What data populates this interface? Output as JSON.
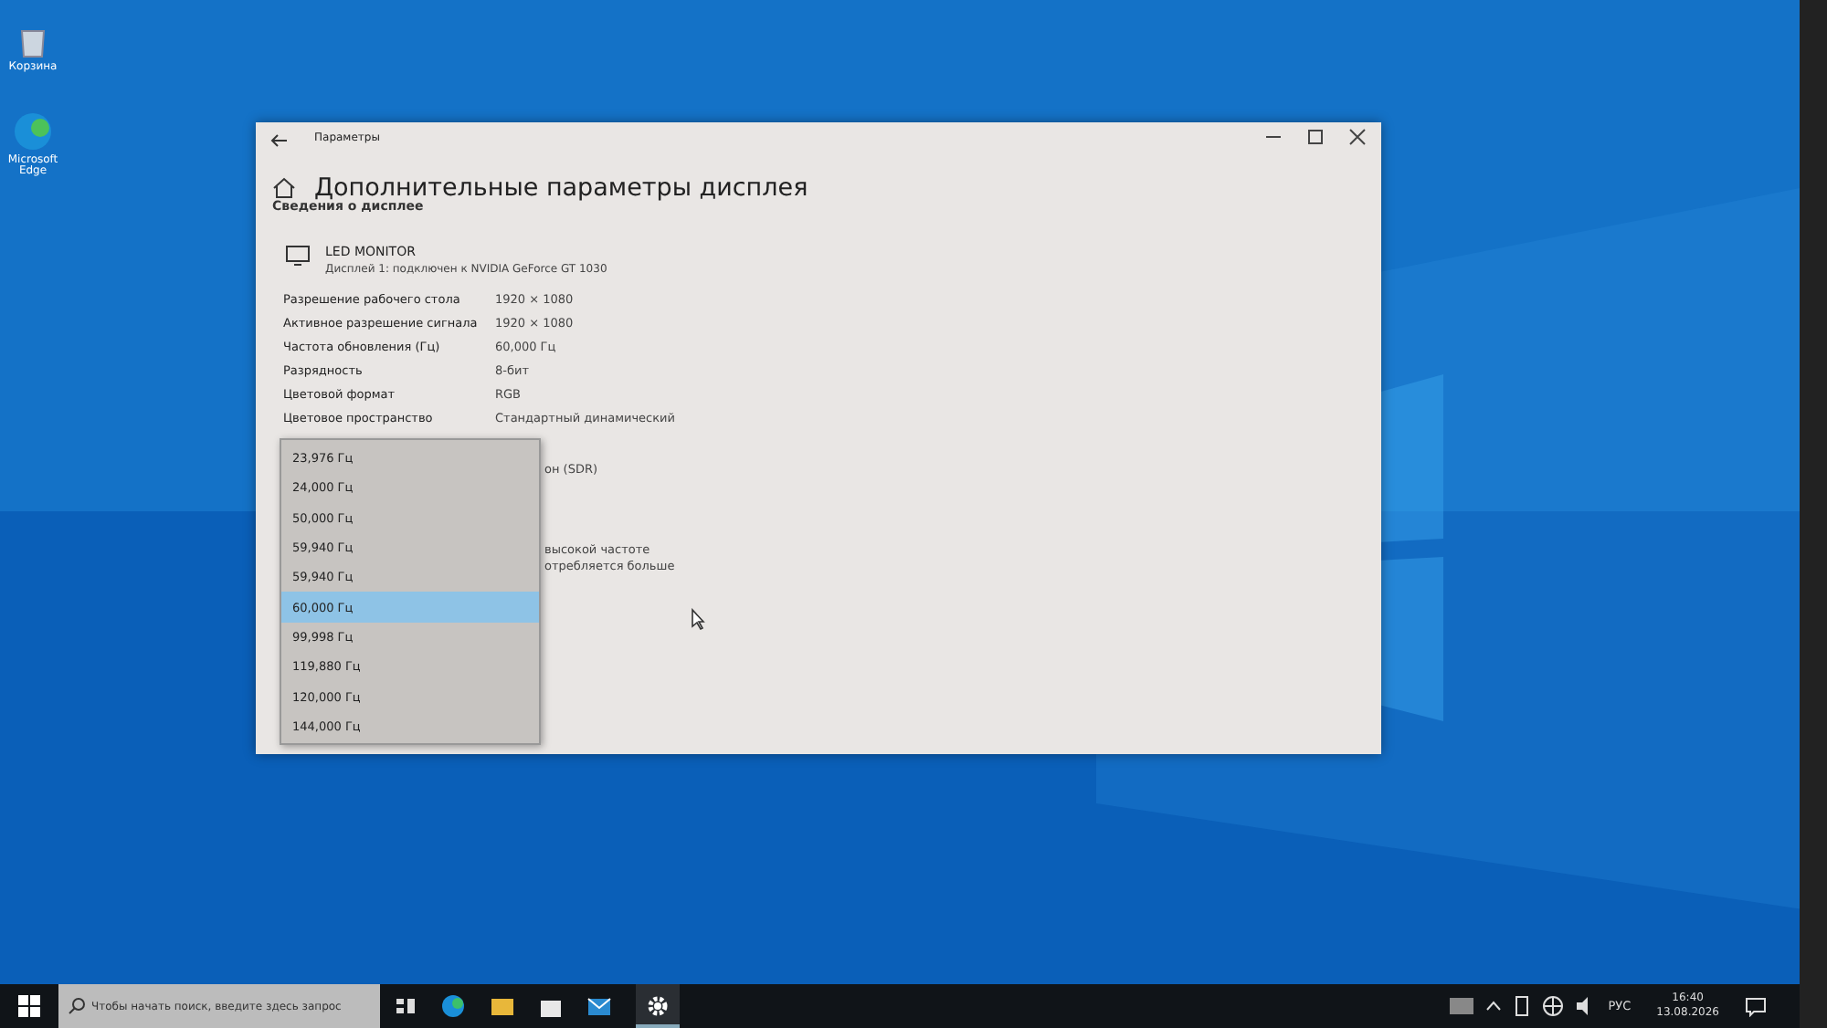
{
  "desktop_icons": [
    {
      "label": "Корзина",
      "kind": "bin"
    },
    {
      "label": "Microsoft Edge",
      "kind": "edge"
    }
  ],
  "window": {
    "title": "Параметры",
    "heading": "Дополнительные параметры дисплея",
    "section_title": "Сведения о дисплее",
    "monitor": {
      "name": "LED MONITOR",
      "description": "Дисплей 1: подключен к NVIDIA GeForce GT 1030"
    },
    "properties": [
      {
        "label": "Разрешение рабочего стола",
        "value": "1920 × 1080"
      },
      {
        "label": "Активное разрешение сигнала",
        "value": "1920 × 1080"
      },
      {
        "label": "Частота обновления (Гц)",
        "value": "60,000 Гц"
      },
      {
        "label": "Разрядность",
        "value": "8-бит"
      },
      {
        "label": "Цветовой формат",
        "value": "RGB"
      },
      {
        "label": "Цветовое пространство",
        "value": "Стандартный динамический"
      }
    ],
    "partial_texts": [
      "он (SDR)",
      "высокой частоте",
      "отребляется больше"
    ]
  },
  "dropdown": [
    {
      "label": "23,976 Гц",
      "selected": false
    },
    {
      "label": "24,000 Гц",
      "selected": false
    },
    {
      "label": "50,000 Гц",
      "selected": false
    },
    {
      "label": "59,940 Гц",
      "selected": false
    },
    {
      "label": "59,940 Гц",
      "selected": false
    },
    {
      "label": "60,000 Гц",
      "selected": true
    },
    {
      "label": "99,998 Гц",
      "selected": false
    },
    {
      "label": "119,880 Гц",
      "selected": false
    },
    {
      "label": "120,000 Гц",
      "selected": false
    },
    {
      "label": "144,000 Гц",
      "selected": false
    }
  ],
  "taskbar": {
    "search_placeholder": "Чтобы начать поиск, введите здесь запрос",
    "language": "РУС",
    "time": "16:40",
    "date": "13.08.2026"
  }
}
